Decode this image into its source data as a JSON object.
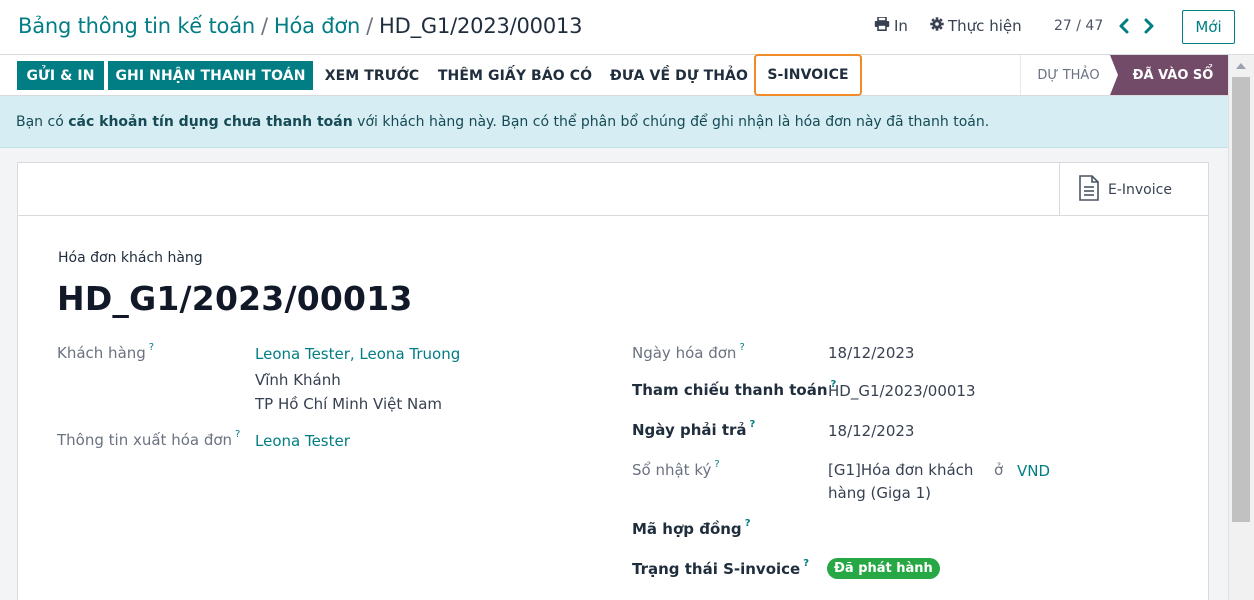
{
  "breadcrumb": {
    "crumb1": "Bảng thông tin kế toán",
    "crumb2": "Hóa đơn",
    "current": "HD_G1/2023/00013",
    "separator": "/"
  },
  "toolbar": {
    "print_label": "In",
    "action_label": "Thực hiện",
    "pager": "27 / 47",
    "new_label": "Mới"
  },
  "buttons": {
    "send_print": "GỬI & IN",
    "register_payment": "GHI NHẬN THANH TOÁN",
    "preview": "XEM TRƯỚC",
    "add_credit_note": "THÊM GIẤY BÁO CÓ",
    "reset_to_draft": "ĐƯA VỀ DỰ THẢO",
    "s_invoice": "S-INVOICE"
  },
  "status": {
    "draft": "DỰ THẢO",
    "posted": "ĐÃ VÀO SỔ"
  },
  "alert": {
    "prefix": "Bạn có ",
    "bold": "các khoản tín dụng chưa thanh toán",
    "suffix": " với khách hàng này. Bạn có thể phân bổ chúng để ghi nhận là hóa đơn này đã thanh toán."
  },
  "sheet": {
    "einvoice_label": "E-Invoice",
    "doc_type": "Hóa đơn khách hàng",
    "doc_number": "HD_G1/2023/00013"
  },
  "fields": {
    "customer_label": "Khách hàng",
    "customer_name": "Leona Tester, Leona Truong",
    "customer_addr1": "Vĩnh Khánh",
    "customer_addr2": "TP Hồ Chí Minh Việt Nam",
    "invoice_info_label": "Thông tin xuất hóa đơn",
    "invoice_info_value": "Leona Tester",
    "invoice_date_label": "Ngày hóa đơn",
    "invoice_date": "18/12/2023",
    "payment_ref_label": "Tham chiếu thanh toán",
    "payment_ref": "HD_G1/2023/00013",
    "due_date_label": "Ngày phải trả",
    "due_date": "18/12/2023",
    "journal_label": "Sổ nhật ký",
    "journal_line1": "[G1]Hóa đơn khách",
    "journal_line2": "hàng (Giga 1)",
    "journal_in": "ở",
    "currency": "VND",
    "contract_label": "Mã hợp đồng",
    "sinvoice_status_label": "Trạng thái S-invoice",
    "sinvoice_status": "Đã phát hành",
    "help_mark": "?"
  },
  "icons": {
    "print": "printer-icon",
    "action": "gear-icon",
    "prev": "chevron-left-icon",
    "next": "chevron-right-icon",
    "einvoice": "document-icon"
  },
  "colors": {
    "primary": "#017e84",
    "posted": "#714b67",
    "highlight": "#f08c28",
    "badge": "#28a745",
    "alert_bg": "#d6eef3"
  }
}
